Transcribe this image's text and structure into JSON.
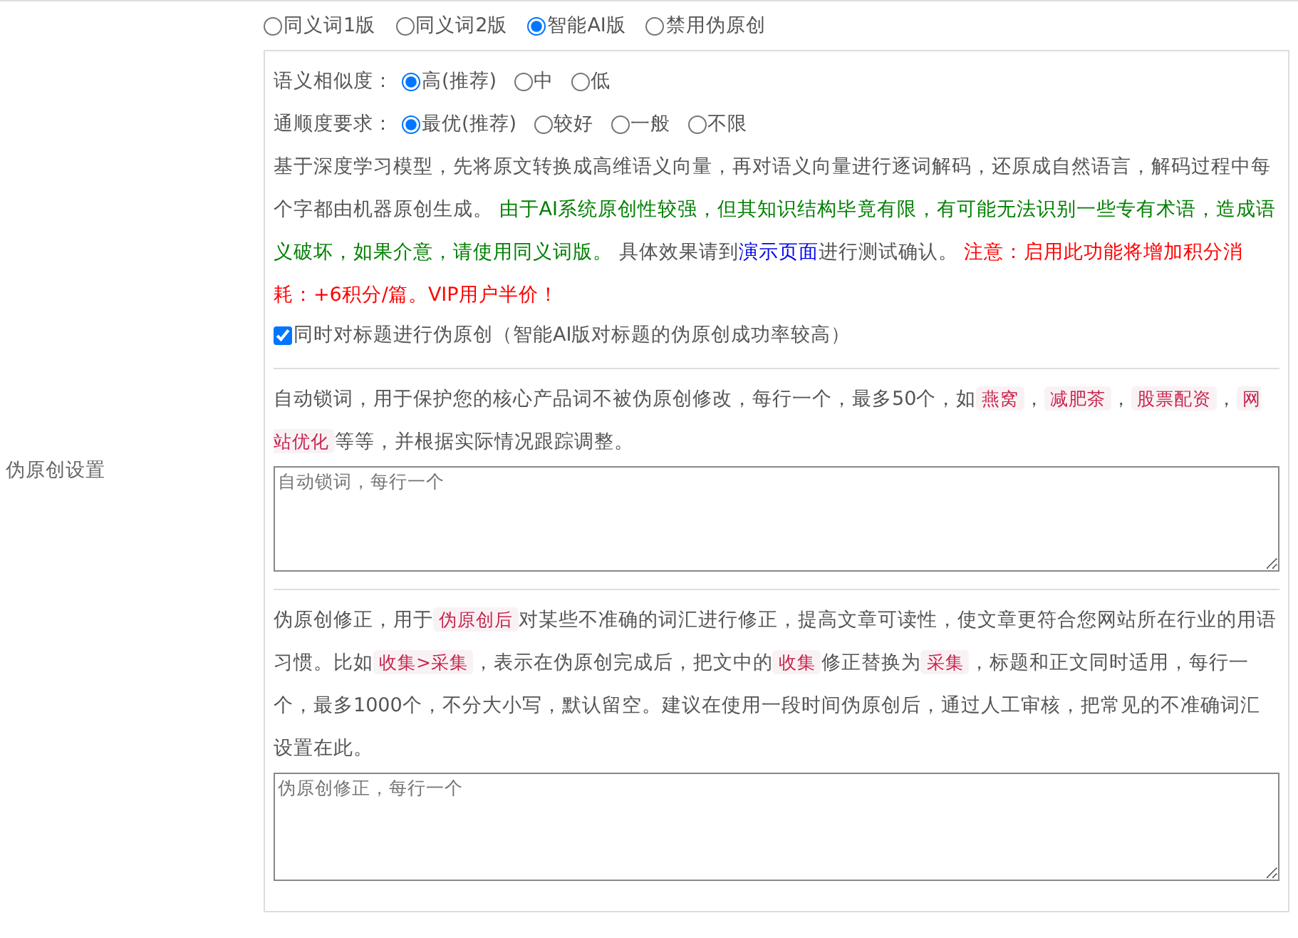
{
  "modes": [
    {
      "label": "同义词1版",
      "selected": false
    },
    {
      "label": "同义词2版",
      "selected": false
    },
    {
      "label": "智能AI版",
      "selected": true
    },
    {
      "label": "禁用伪原创",
      "selected": false
    }
  ],
  "settings_label": "伪原创设置",
  "similarity": {
    "label": "语义相似度：",
    "options": [
      {
        "label": "高(推荐)",
        "selected": true
      },
      {
        "label": "中",
        "selected": false
      },
      {
        "label": "低",
        "selected": false
      }
    ]
  },
  "fluency": {
    "label": "通顺度要求：",
    "options": [
      {
        "label": "最优(推荐)",
        "selected": true
      },
      {
        "label": "较好",
        "selected": false
      },
      {
        "label": "一般",
        "selected": false
      },
      {
        "label": "不限",
        "selected": false
      }
    ]
  },
  "ai_description": [
    {
      "kind": "text",
      "text": "基于深度学习模型，先将原文转换成高维语义向量，再对语义向量进行逐词解码，还原成自然语言，解码过程中每个字都由机器原创生成。 "
    },
    {
      "kind": "notice",
      "text": "由于AI系统原创性较强，但其知识结构毕竟有限，有可能无法识别一些专有术语，造成语义破坏，如果介意，请使用同义词版。"
    },
    {
      "kind": "text",
      "text": " 具体效果请到"
    },
    {
      "kind": "link",
      "text": "演示页面"
    },
    {
      "kind": "text",
      "text": "进行测试确认。 "
    },
    {
      "kind": "alert",
      "text": "注意：启用此功能将增加积分消耗：+6积分/篇。VIP用户半价！"
    }
  ],
  "title_option": {
    "label": "同时对标题进行伪原创（智能AI版对标题的伪原创成功率较高）",
    "checked": true
  },
  "lock_words": {
    "description": [
      {
        "kind": "text",
        "text": "自动锁词，用于保护您的核心产品词不被伪原创修改，每行一个，最多50个，如"
      },
      {
        "kind": "code",
        "text": "燕窝"
      },
      {
        "kind": "text",
        "text": "，"
      },
      {
        "kind": "code",
        "text": "减肥茶"
      },
      {
        "kind": "text",
        "text": "，"
      },
      {
        "kind": "code",
        "text": "股票配资"
      },
      {
        "kind": "text",
        "text": "，"
      },
      {
        "kind": "code",
        "text": "网站优化"
      },
      {
        "kind": "text",
        "text": "等等，并根据实际情况跟踪调整。"
      }
    ],
    "placeholder": "自动锁词，每行一个"
  },
  "correction": {
    "description": [
      {
        "kind": "text",
        "text": "伪原创修正，用于"
      },
      {
        "kind": "code",
        "text": "伪原创后"
      },
      {
        "kind": "text",
        "text": "对某些不准确的词汇进行修正，提高文章可读性，使文章更符合您网站所在行业的用语习惯。比如"
      },
      {
        "kind": "code",
        "text": "收集>采集"
      },
      {
        "kind": "text",
        "text": "，表示在伪原创完成后，把文中的"
      },
      {
        "kind": "code",
        "text": "收集"
      },
      {
        "kind": "text",
        "text": "修正替换为"
      },
      {
        "kind": "code",
        "text": "采集"
      },
      {
        "kind": "text",
        "text": "，标题和正文同时适用，每行一个，最多1000个，不分大小写，默认留空。建议在使用一段时间伪原创后，通过人工审核，把常见的不准确词汇设置在此。"
      }
    ],
    "placeholder": "伪原创修正，每行一个"
  }
}
